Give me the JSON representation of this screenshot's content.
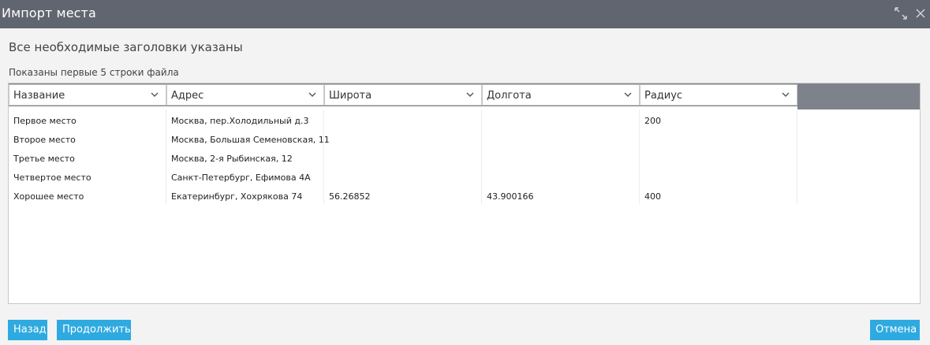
{
  "dialog": {
    "title": "Импорт места"
  },
  "status_heading": "Все необходимые заголовки указаны",
  "preview_note": "Показаны первые 5 строки файла",
  "columns": [
    {
      "label": "Название"
    },
    {
      "label": "Адрес"
    },
    {
      "label": "Широта"
    },
    {
      "label": "Долгота"
    },
    {
      "label": "Радиус"
    }
  ],
  "rows": [
    [
      "Первое место",
      "Москва, пер.Холодильный д.3",
      "",
      "",
      "200"
    ],
    [
      "Второе место",
      "Москва, Большая Семеновская, 11",
      "",
      "",
      ""
    ],
    [
      "Третье место",
      "Москва, 2-я Рыбинская, 12",
      "",
      "",
      ""
    ],
    [
      "Четвертое место",
      "Санкт-Петербург, Ефимова 4А",
      "",
      "",
      ""
    ],
    [
      "Хорошее место",
      "Екатеринбург, Хохрякова 74",
      "56.26852",
      "43.900166",
      "400"
    ]
  ],
  "buttons": {
    "back": "Назад",
    "continue": "Продолжить",
    "cancel": "Отмена"
  },
  "colors": {
    "titlebar": "#616570",
    "header_band": "#7e828b",
    "accent": "#2eaae0"
  },
  "icons": {
    "expand": "expand-icon",
    "close": "close-icon",
    "column_dropdown": "chevron-down-icon"
  }
}
